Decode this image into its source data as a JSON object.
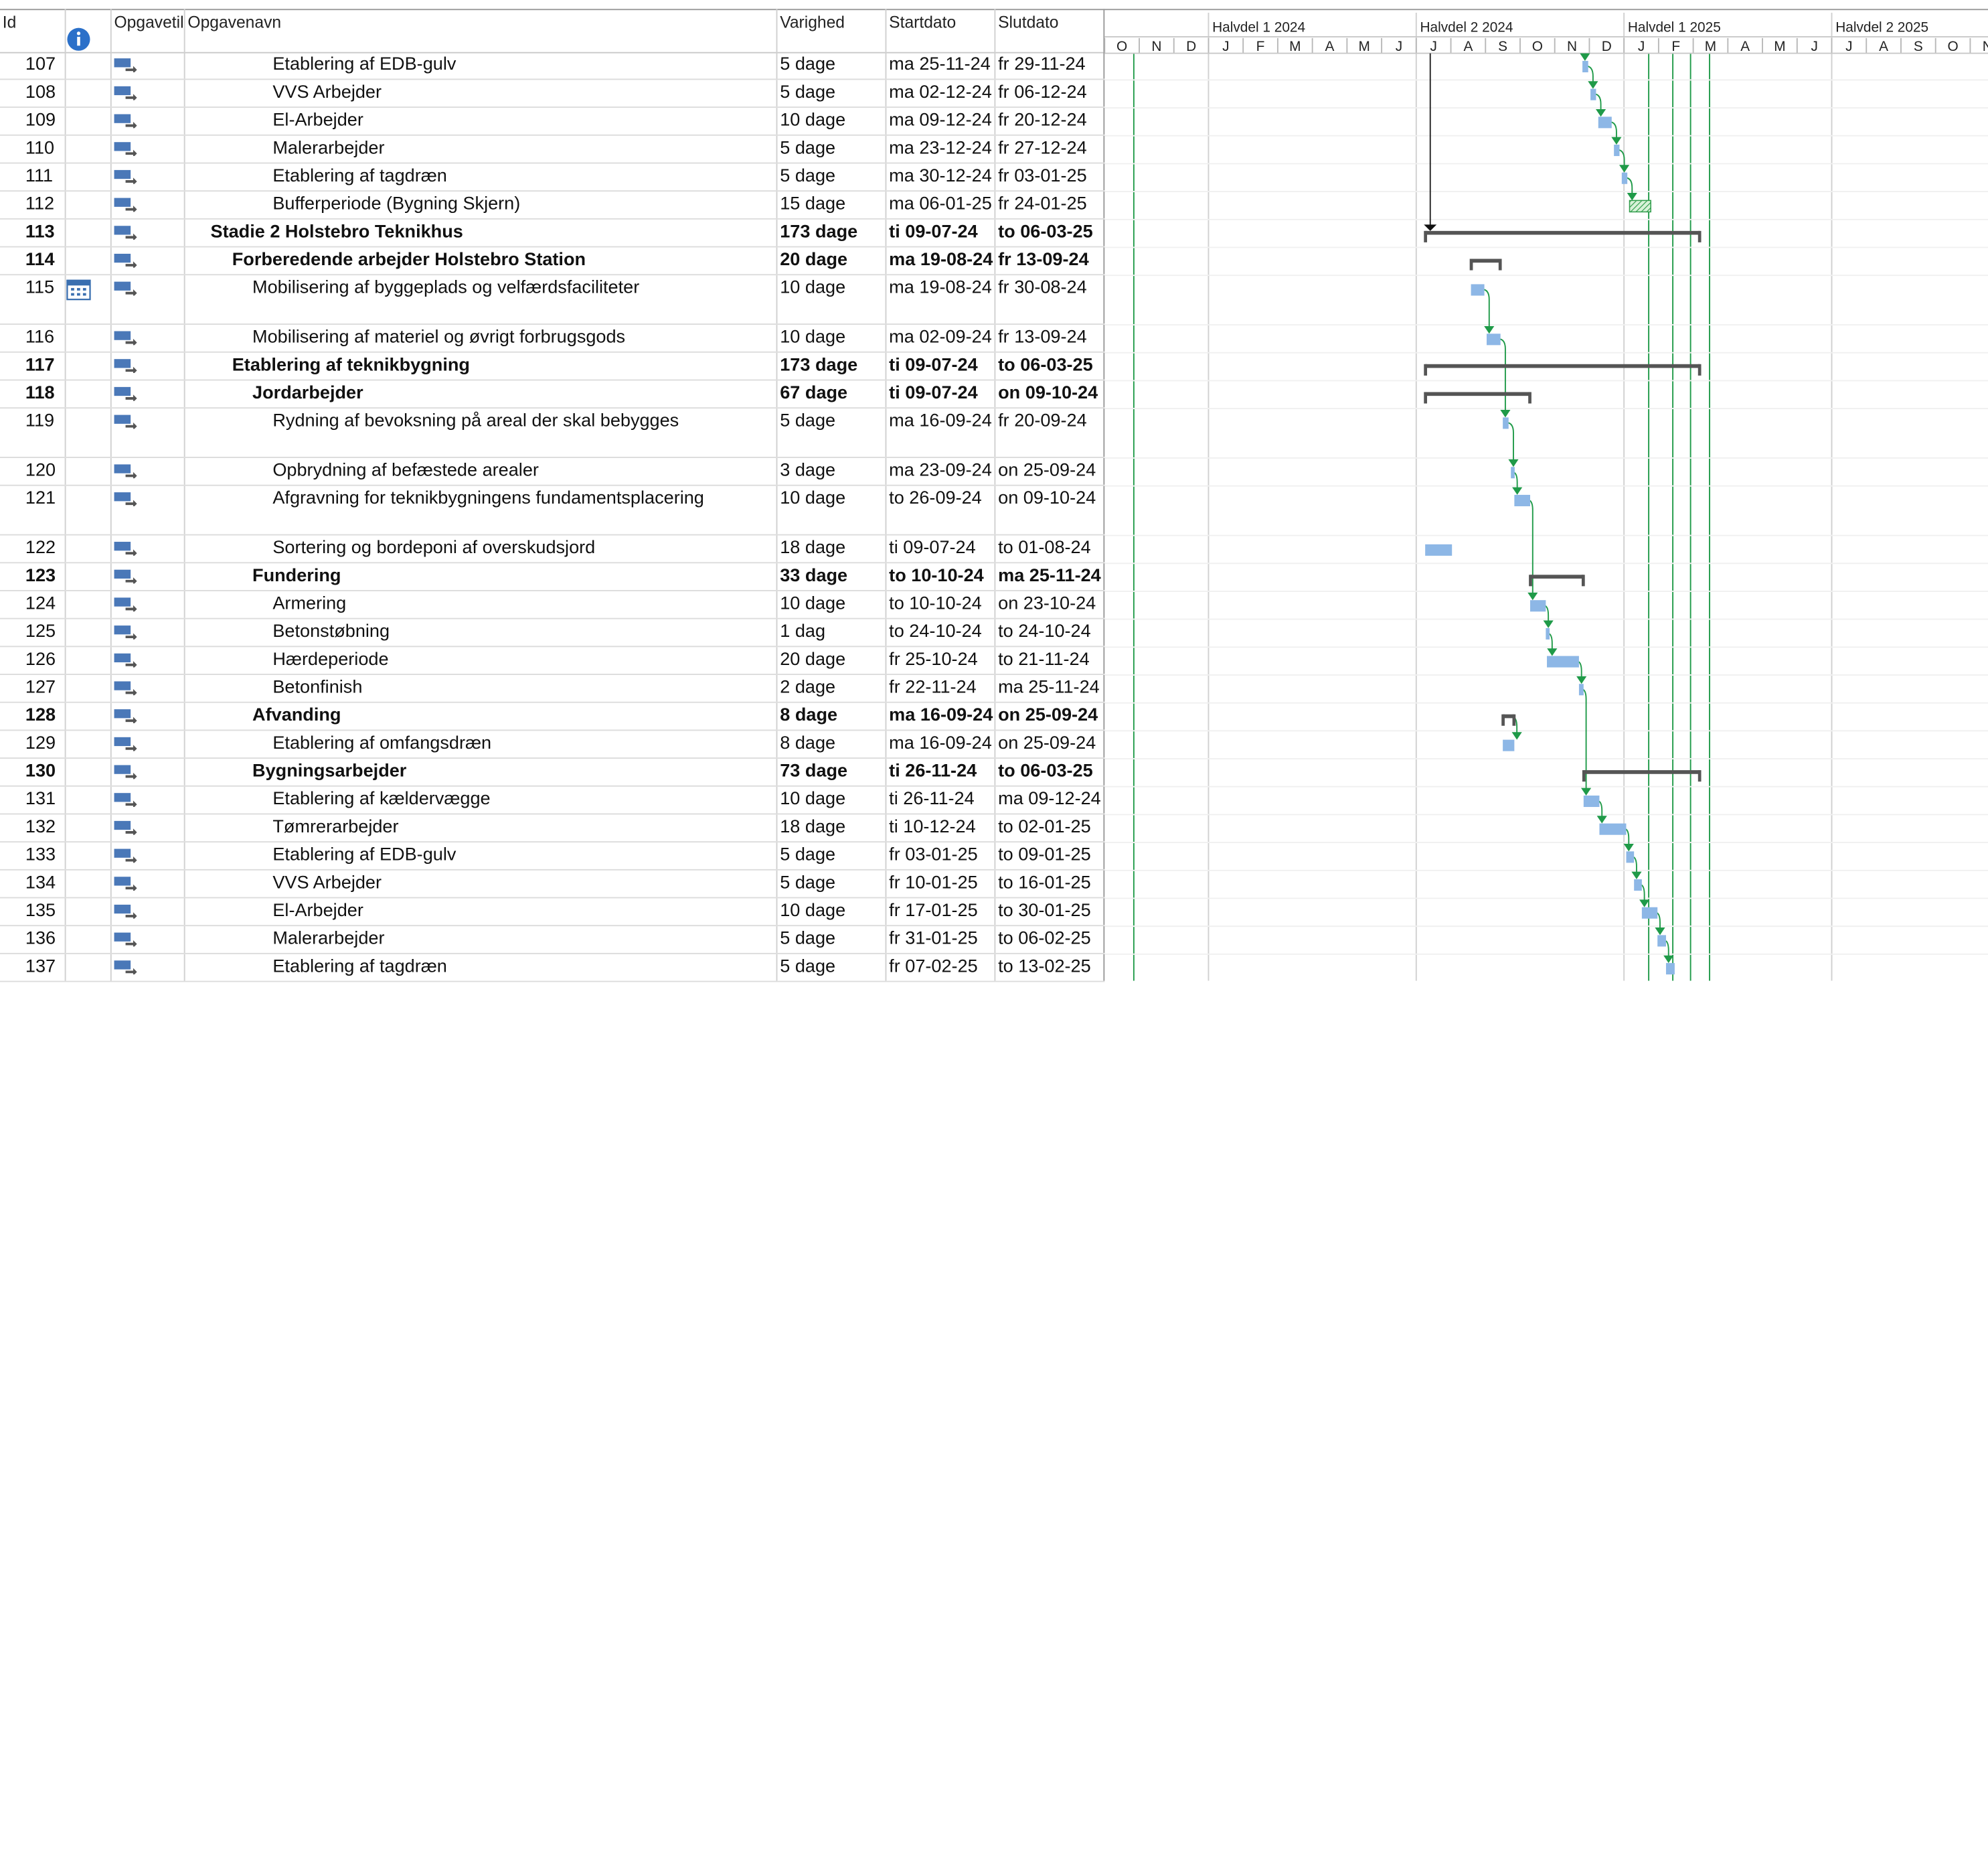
{
  "headers": {
    "id": "Id",
    "info": "info-icon",
    "mode": "Opgavetilstand",
    "name": "Opgavenavn",
    "duration": "Varighed",
    "start": "Startdato",
    "end": "Slutdato"
  },
  "timescale": {
    "halves": [
      "Halvdel 1 2024",
      "Halvdel 2 2024",
      "Halvdel 1 2025",
      "Halvdel 2 2025"
    ],
    "months": [
      "O",
      "N",
      "D",
      "J",
      "F",
      "M",
      "A",
      "M",
      "J",
      "J",
      "A",
      "S",
      "O",
      "N",
      "D",
      "J",
      "F",
      "M",
      "A",
      "M",
      "J",
      "J",
      "A",
      "S",
      "O",
      "N"
    ]
  },
  "colors": {
    "bar": "#8db7e6",
    "link": "#1f9a48",
    "summary": "#555555",
    "buffer": "#7bd27b",
    "gridline": "#dcdcdc",
    "info_icon": "#2b70c9"
  },
  "tasks": [
    {
      "id": "107",
      "name": "Etablering af EDB-gulv",
      "level": 3,
      "duration": "5 dage",
      "start": "ma 25-11-24",
      "end": "fr 29-11-24",
      "bold": false
    },
    {
      "id": "108",
      "name": "VVS Arbejder",
      "level": 3,
      "duration": "5 dage",
      "start": "ma 02-12-24",
      "end": "fr 06-12-24",
      "bold": false
    },
    {
      "id": "109",
      "name": "El-Arbejder",
      "level": 3,
      "duration": "10 dage",
      "start": "ma 09-12-24",
      "end": "fr 20-12-24",
      "bold": false
    },
    {
      "id": "110",
      "name": "Malerarbejder",
      "level": 3,
      "duration": "5 dage",
      "start": "ma 23-12-24",
      "end": "fr 27-12-24",
      "bold": false
    },
    {
      "id": "111",
      "name": "Etablering af tagdræn",
      "level": 3,
      "duration": "5 dage",
      "start": "ma 30-12-24",
      "end": "fr 03-01-25",
      "bold": false
    },
    {
      "id": "112",
      "name": "Bufferperiode (Bygning Skjern)",
      "level": 3,
      "duration": "15 dage",
      "start": "ma 06-01-25",
      "end": "fr 24-01-25",
      "bold": false
    },
    {
      "id": "113",
      "name": "Stadie 2 Holstebro Teknikhus",
      "level": 0,
      "duration": "173 dage",
      "start": "ti 09-07-24",
      "end": "to 06-03-25",
      "bold": true
    },
    {
      "id": "114",
      "name": "Forberedende arbejder Holstebro Station",
      "level": 1,
      "duration": "20 dage",
      "start": "ma 19-08-24",
      "end": "fr 13-09-24",
      "bold": true
    },
    {
      "id": "115",
      "name": "Mobilisering af byggeplads og velfærdsfaciliteter",
      "level": 2,
      "duration": "10 dage",
      "start": "ma 19-08-24",
      "end": "fr 30-08-24",
      "bold": false,
      "tall": true,
      "calendar": true
    },
    {
      "id": "116",
      "name": "Mobilisering af materiel og øvrigt forbrugsgods",
      "level": 2,
      "duration": "10 dage",
      "start": "ma 02-09-24",
      "end": "fr 13-09-24",
      "bold": false
    },
    {
      "id": "117",
      "name": "Etablering af teknikbygning",
      "level": 1,
      "duration": "173 dage",
      "start": "ti 09-07-24",
      "end": "to 06-03-25",
      "bold": true
    },
    {
      "id": "118",
      "name": "Jordarbejder",
      "level": 2,
      "duration": "67 dage",
      "start": "ti 09-07-24",
      "end": "on 09-10-24",
      "bold": true
    },
    {
      "id": "119",
      "name": "Rydning af bevoksning på areal der skal bebygges",
      "level": 3,
      "duration": "5 dage",
      "start": "ma 16-09-24",
      "end": "fr 20-09-24",
      "bold": false,
      "tall": true
    },
    {
      "id": "120",
      "name": "Opbrydning af befæstede arealer",
      "level": 3,
      "duration": "3 dage",
      "start": "ma 23-09-24",
      "end": "on 25-09-24",
      "bold": false
    },
    {
      "id": "121",
      "name": "Afgravning for teknikbygningens fundamentsplacering",
      "level": 3,
      "duration": "10 dage",
      "start": "to 26-09-24",
      "end": "on 09-10-24",
      "bold": false,
      "tall": true
    },
    {
      "id": "122",
      "name": "Sortering og bordeponi af overskudsjord",
      "level": 3,
      "duration": "18 dage",
      "start": "ti 09-07-24",
      "end": "to 01-08-24",
      "bold": false
    },
    {
      "id": "123",
      "name": "Fundering",
      "level": 2,
      "duration": "33 dage",
      "start": "to 10-10-24",
      "end": "ma 25-11-24",
      "bold": true
    },
    {
      "id": "124",
      "name": "Armering",
      "level": 3,
      "duration": "10 dage",
      "start": "to 10-10-24",
      "end": "on 23-10-24",
      "bold": false
    },
    {
      "id": "125",
      "name": "Betonstøbning",
      "level": 3,
      "duration": "1 dag",
      "start": "to 24-10-24",
      "end": "to 24-10-24",
      "bold": false
    },
    {
      "id": "126",
      "name": "Hærdeperiode",
      "level": 3,
      "duration": "20 dage",
      "start": "fr 25-10-24",
      "end": "to 21-11-24",
      "bold": false
    },
    {
      "id": "127",
      "name": "Betonfinish",
      "level": 3,
      "duration": "2 dage",
      "start": "fr 22-11-24",
      "end": "ma 25-11-24",
      "bold": false
    },
    {
      "id": "128",
      "name": "Afvanding",
      "level": 2,
      "duration": "8 dage",
      "start": "ma 16-09-24",
      "end": "on 25-09-24",
      "bold": true
    },
    {
      "id": "129",
      "name": "Etablering af omfangsdræn",
      "level": 3,
      "duration": "8 dage",
      "start": "ma 16-09-24",
      "end": "on 25-09-24",
      "bold": false
    },
    {
      "id": "130",
      "name": "Bygningsarbejder",
      "level": 2,
      "duration": "73 dage",
      "start": "ti 26-11-24",
      "end": "to 06-03-25",
      "bold": true
    },
    {
      "id": "131",
      "name": "Etablering af kældervægge",
      "level": 3,
      "duration": "10 dage",
      "start": "ti 26-11-24",
      "end": "ma 09-12-24",
      "bold": false
    },
    {
      "id": "132",
      "name": "Tømrerarbejder",
      "level": 3,
      "duration": "18 dage",
      "start": "ti 10-12-24",
      "end": "to 02-01-25",
      "bold": false
    },
    {
      "id": "133",
      "name": "Etablering af EDB-gulv",
      "level": 3,
      "duration": "5 dage",
      "start": "fr 03-01-25",
      "end": "to 09-01-25",
      "bold": false
    },
    {
      "id": "134",
      "name": "VVS Arbejder",
      "level": 3,
      "duration": "5 dage",
      "start": "fr 10-01-25",
      "end": "to 16-01-25",
      "bold": false
    },
    {
      "id": "135",
      "name": "El-Arbejder",
      "level": 3,
      "duration": "10 dage",
      "start": "fr 17-01-25",
      "end": "to 30-01-25",
      "bold": false
    },
    {
      "id": "136",
      "name": "Malerarbejder",
      "level": 3,
      "duration": "5 dage",
      "start": "fr 31-01-25",
      "end": "to 06-02-25",
      "bold": false
    },
    {
      "id": "137",
      "name": "Etablering af tagdræn",
      "level": 3,
      "duration": "5 dage",
      "start": "fr 07-02-25",
      "end": "to 13-02-25",
      "bold": false
    }
  ]
}
